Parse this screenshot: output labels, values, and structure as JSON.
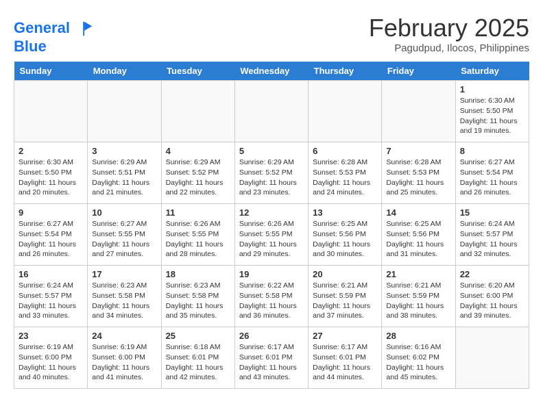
{
  "header": {
    "logo_line1": "General",
    "logo_line2": "Blue",
    "month_year": "February 2025",
    "location": "Pagudpud, Ilocos, Philippines"
  },
  "days_of_week": [
    "Sunday",
    "Monday",
    "Tuesday",
    "Wednesday",
    "Thursday",
    "Friday",
    "Saturday"
  ],
  "weeks": [
    [
      {
        "day": "",
        "content": ""
      },
      {
        "day": "",
        "content": ""
      },
      {
        "day": "",
        "content": ""
      },
      {
        "day": "",
        "content": ""
      },
      {
        "day": "",
        "content": ""
      },
      {
        "day": "",
        "content": ""
      },
      {
        "day": "1",
        "content": "Sunrise: 6:30 AM\nSunset: 5:50 PM\nDaylight: 11 hours\nand 19 minutes."
      }
    ],
    [
      {
        "day": "2",
        "content": "Sunrise: 6:30 AM\nSunset: 5:50 PM\nDaylight: 11 hours\nand 20 minutes."
      },
      {
        "day": "3",
        "content": "Sunrise: 6:29 AM\nSunset: 5:51 PM\nDaylight: 11 hours\nand 21 minutes."
      },
      {
        "day": "4",
        "content": "Sunrise: 6:29 AM\nSunset: 5:52 PM\nDaylight: 11 hours\nand 22 minutes."
      },
      {
        "day": "5",
        "content": "Sunrise: 6:29 AM\nSunset: 5:52 PM\nDaylight: 11 hours\nand 23 minutes."
      },
      {
        "day": "6",
        "content": "Sunrise: 6:28 AM\nSunset: 5:53 PM\nDaylight: 11 hours\nand 24 minutes."
      },
      {
        "day": "7",
        "content": "Sunrise: 6:28 AM\nSunset: 5:53 PM\nDaylight: 11 hours\nand 25 minutes."
      },
      {
        "day": "8",
        "content": "Sunrise: 6:27 AM\nSunset: 5:54 PM\nDaylight: 11 hours\nand 26 minutes."
      }
    ],
    [
      {
        "day": "9",
        "content": "Sunrise: 6:27 AM\nSunset: 5:54 PM\nDaylight: 11 hours\nand 26 minutes."
      },
      {
        "day": "10",
        "content": "Sunrise: 6:27 AM\nSunset: 5:55 PM\nDaylight: 11 hours\nand 27 minutes."
      },
      {
        "day": "11",
        "content": "Sunrise: 6:26 AM\nSunset: 5:55 PM\nDaylight: 11 hours\nand 28 minutes."
      },
      {
        "day": "12",
        "content": "Sunrise: 6:26 AM\nSunset: 5:55 PM\nDaylight: 11 hours\nand 29 minutes."
      },
      {
        "day": "13",
        "content": "Sunrise: 6:25 AM\nSunset: 5:56 PM\nDaylight: 11 hours\nand 30 minutes."
      },
      {
        "day": "14",
        "content": "Sunrise: 6:25 AM\nSunset: 5:56 PM\nDaylight: 11 hours\nand 31 minutes."
      },
      {
        "day": "15",
        "content": "Sunrise: 6:24 AM\nSunset: 5:57 PM\nDaylight: 11 hours\nand 32 minutes."
      }
    ],
    [
      {
        "day": "16",
        "content": "Sunrise: 6:24 AM\nSunset: 5:57 PM\nDaylight: 11 hours\nand 33 minutes."
      },
      {
        "day": "17",
        "content": "Sunrise: 6:23 AM\nSunset: 5:58 PM\nDaylight: 11 hours\nand 34 minutes."
      },
      {
        "day": "18",
        "content": "Sunrise: 6:23 AM\nSunset: 5:58 PM\nDaylight: 11 hours\nand 35 minutes."
      },
      {
        "day": "19",
        "content": "Sunrise: 6:22 AM\nSunset: 5:58 PM\nDaylight: 11 hours\nand 36 minutes."
      },
      {
        "day": "20",
        "content": "Sunrise: 6:21 AM\nSunset: 5:59 PM\nDaylight: 11 hours\nand 37 minutes."
      },
      {
        "day": "21",
        "content": "Sunrise: 6:21 AM\nSunset: 5:59 PM\nDaylight: 11 hours\nand 38 minutes."
      },
      {
        "day": "22",
        "content": "Sunrise: 6:20 AM\nSunset: 6:00 PM\nDaylight: 11 hours\nand 39 minutes."
      }
    ],
    [
      {
        "day": "23",
        "content": "Sunrise: 6:19 AM\nSunset: 6:00 PM\nDaylight: 11 hours\nand 40 minutes."
      },
      {
        "day": "24",
        "content": "Sunrise: 6:19 AM\nSunset: 6:00 PM\nDaylight: 11 hours\nand 41 minutes."
      },
      {
        "day": "25",
        "content": "Sunrise: 6:18 AM\nSunset: 6:01 PM\nDaylight: 11 hours\nand 42 minutes."
      },
      {
        "day": "26",
        "content": "Sunrise: 6:17 AM\nSunset: 6:01 PM\nDaylight: 11 hours\nand 43 minutes."
      },
      {
        "day": "27",
        "content": "Sunrise: 6:17 AM\nSunset: 6:01 PM\nDaylight: 11 hours\nand 44 minutes."
      },
      {
        "day": "28",
        "content": "Sunrise: 6:16 AM\nSunset: 6:02 PM\nDaylight: 11 hours\nand 45 minutes."
      },
      {
        "day": "",
        "content": ""
      }
    ]
  ]
}
